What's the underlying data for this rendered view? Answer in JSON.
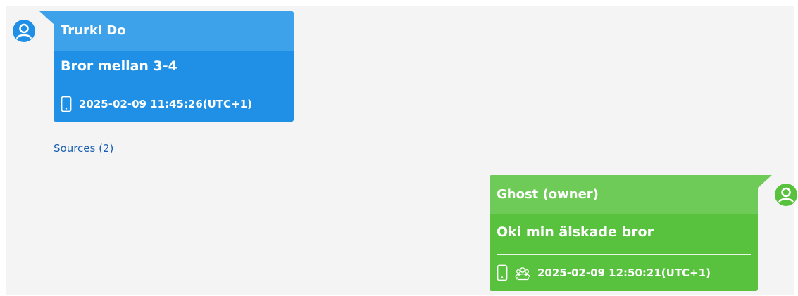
{
  "messages": [
    {
      "direction": "incoming",
      "sender": "Trurki Do",
      "text": "Bror mellan 3-4",
      "timestamp": "2025-02-09 11:45:26(UTC+1)",
      "icons": [
        "mobile-phone-icon"
      ],
      "sources_label": "Sources (2)",
      "avatar_icon": "user-icon",
      "color": "#1f90e6"
    },
    {
      "direction": "outgoing",
      "sender": "Ghost (owner)",
      "text": "Oki min älskade bror",
      "timestamp": "2025-02-09 12:50:21(UTC+1)",
      "icons": [
        "mobile-phone-icon",
        "group-icon"
      ],
      "avatar_icon": "user-icon",
      "color": "#58c13e"
    }
  ]
}
